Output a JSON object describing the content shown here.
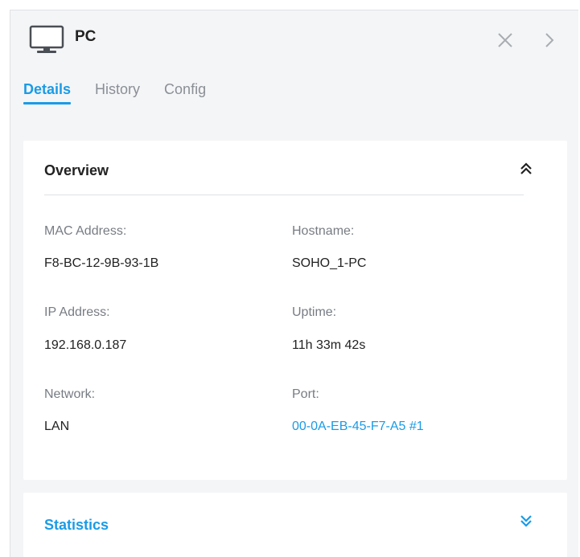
{
  "header": {
    "title": "PC",
    "device_icon": "monitor-icon",
    "close_icon": "close-icon",
    "next_icon": "chevron-right-icon"
  },
  "tabs": [
    {
      "label": "Details",
      "active": true
    },
    {
      "label": "History",
      "active": false
    },
    {
      "label": "Config",
      "active": false
    }
  ],
  "overview": {
    "title": "Overview",
    "collapse_icon": "double-chevron-up-icon",
    "fields": {
      "mac_label": "MAC Address:",
      "mac_value": "F8-BC-12-9B-93-1B",
      "hostname_label": "Hostname:",
      "hostname_value": "SOHO_1-PC",
      "ip_label": "IP Address:",
      "ip_value": "192.168.0.187",
      "uptime_label": "Uptime:",
      "uptime_value": "11h 33m 42s",
      "network_label": "Network:",
      "network_value": "LAN",
      "port_label": "Port:",
      "port_value": "00-0A-EB-45-F7-A5 #1"
    }
  },
  "statistics": {
    "title": "Statistics",
    "expand_icon": "double-chevron-down-icon"
  },
  "colors": {
    "accent": "#1a9be6",
    "panel_bg": "#f4f5f6",
    "card_bg": "#ffffff",
    "label": "#777c83",
    "text": "#222222"
  }
}
